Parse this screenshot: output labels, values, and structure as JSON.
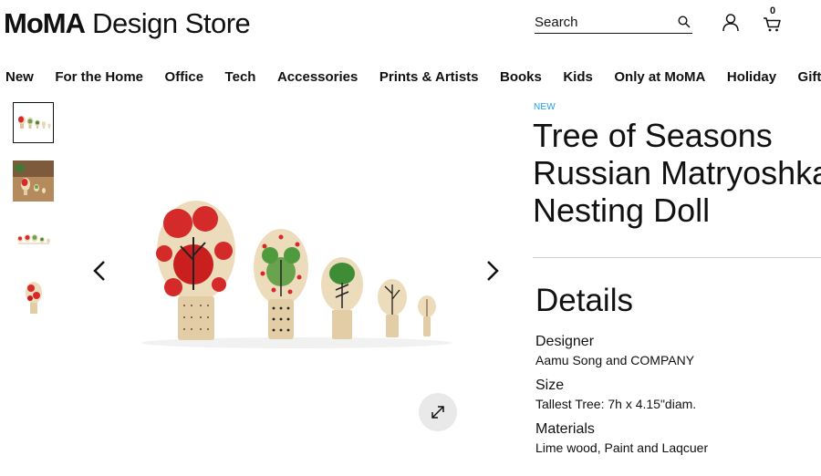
{
  "header": {
    "logo_bold": "MoMA",
    "logo_rest": " Design Store",
    "search_placeholder": "Search",
    "cart_count": "0"
  },
  "nav": {
    "items": [
      "New",
      "For the Home",
      "Office",
      "Tech",
      "Accessories",
      "Prints & Artists",
      "Books",
      "Kids",
      "Only at MoMA",
      "Holiday",
      "Gifts"
    ]
  },
  "product": {
    "badge": "NEW",
    "title_lines": [
      "Tree of Seasons",
      "Russian Matryoshka",
      "Nesting Doll"
    ],
    "details_heading": "Details",
    "specs": [
      {
        "label": "Designer",
        "value": "Aamu Song and COMPANY"
      },
      {
        "label": "Size",
        "value": "Tallest Tree: 7h x 4.15\"diam."
      },
      {
        "label": "Materials",
        "value": "Lime wood, Paint and Laqcuer"
      }
    ]
  },
  "colors": {
    "text": "#111111",
    "badge": "#1b9fe6",
    "divider": "#cfcfcf",
    "expand_bg": "#e9e9e9",
    "doll_red": "#d42a2a",
    "doll_green": "#4e9a3c",
    "doll_wood": "#ecd9b5"
  },
  "icons": {
    "search": "search-icon",
    "user": "user-icon",
    "cart": "cart-icon",
    "prev": "chevron-left-icon",
    "next": "chevron-right-icon",
    "expand": "expand-icon"
  }
}
